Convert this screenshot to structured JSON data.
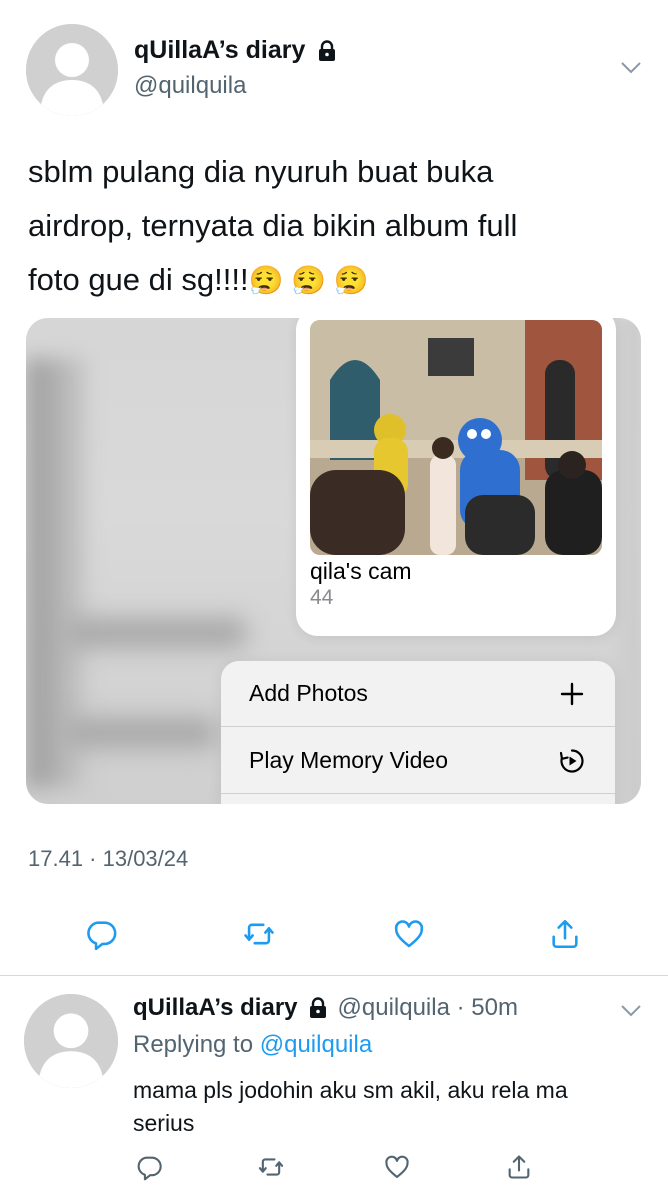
{
  "tweet": {
    "display_name": "qUillaA’s diary",
    "handle": "@quilquila",
    "text_line1": "sblm pulang dia nyuruh buat buka",
    "text_line2": "airdrop, ternyata dia bikin album full",
    "text_line3": "foto gue di sg!!!!",
    "emojis": "😮‍💨 😮‍💨 😮‍💨",
    "timestamp": "17.41 · 13/03/24",
    "media": {
      "album_title": "qila's cam",
      "album_count": "44",
      "menu_items": [
        {
          "label": "Add Photos",
          "icon": "plus-icon"
        },
        {
          "label": "Play Memory Video",
          "icon": "memory-play-icon"
        }
      ]
    },
    "actions": [
      "reply-icon",
      "retweet-icon",
      "like-icon",
      "share-icon"
    ]
  },
  "reply": {
    "display_name": "qUillaA’s diary",
    "handle_time": "@quilquila · 50m",
    "replying_prefix": "Replying to",
    "replying_mention": "@quilquila",
    "text": "mama pls jodohin aku sm akil, aku rela ma serius",
    "actions": [
      "reply-icon",
      "retweet-icon",
      "like-icon",
      "share-icon"
    ]
  },
  "colors": {
    "text": "#0f1419",
    "secondary": "#536471",
    "link": "#1d9bf0",
    "avatar": "#d0d0d0"
  }
}
